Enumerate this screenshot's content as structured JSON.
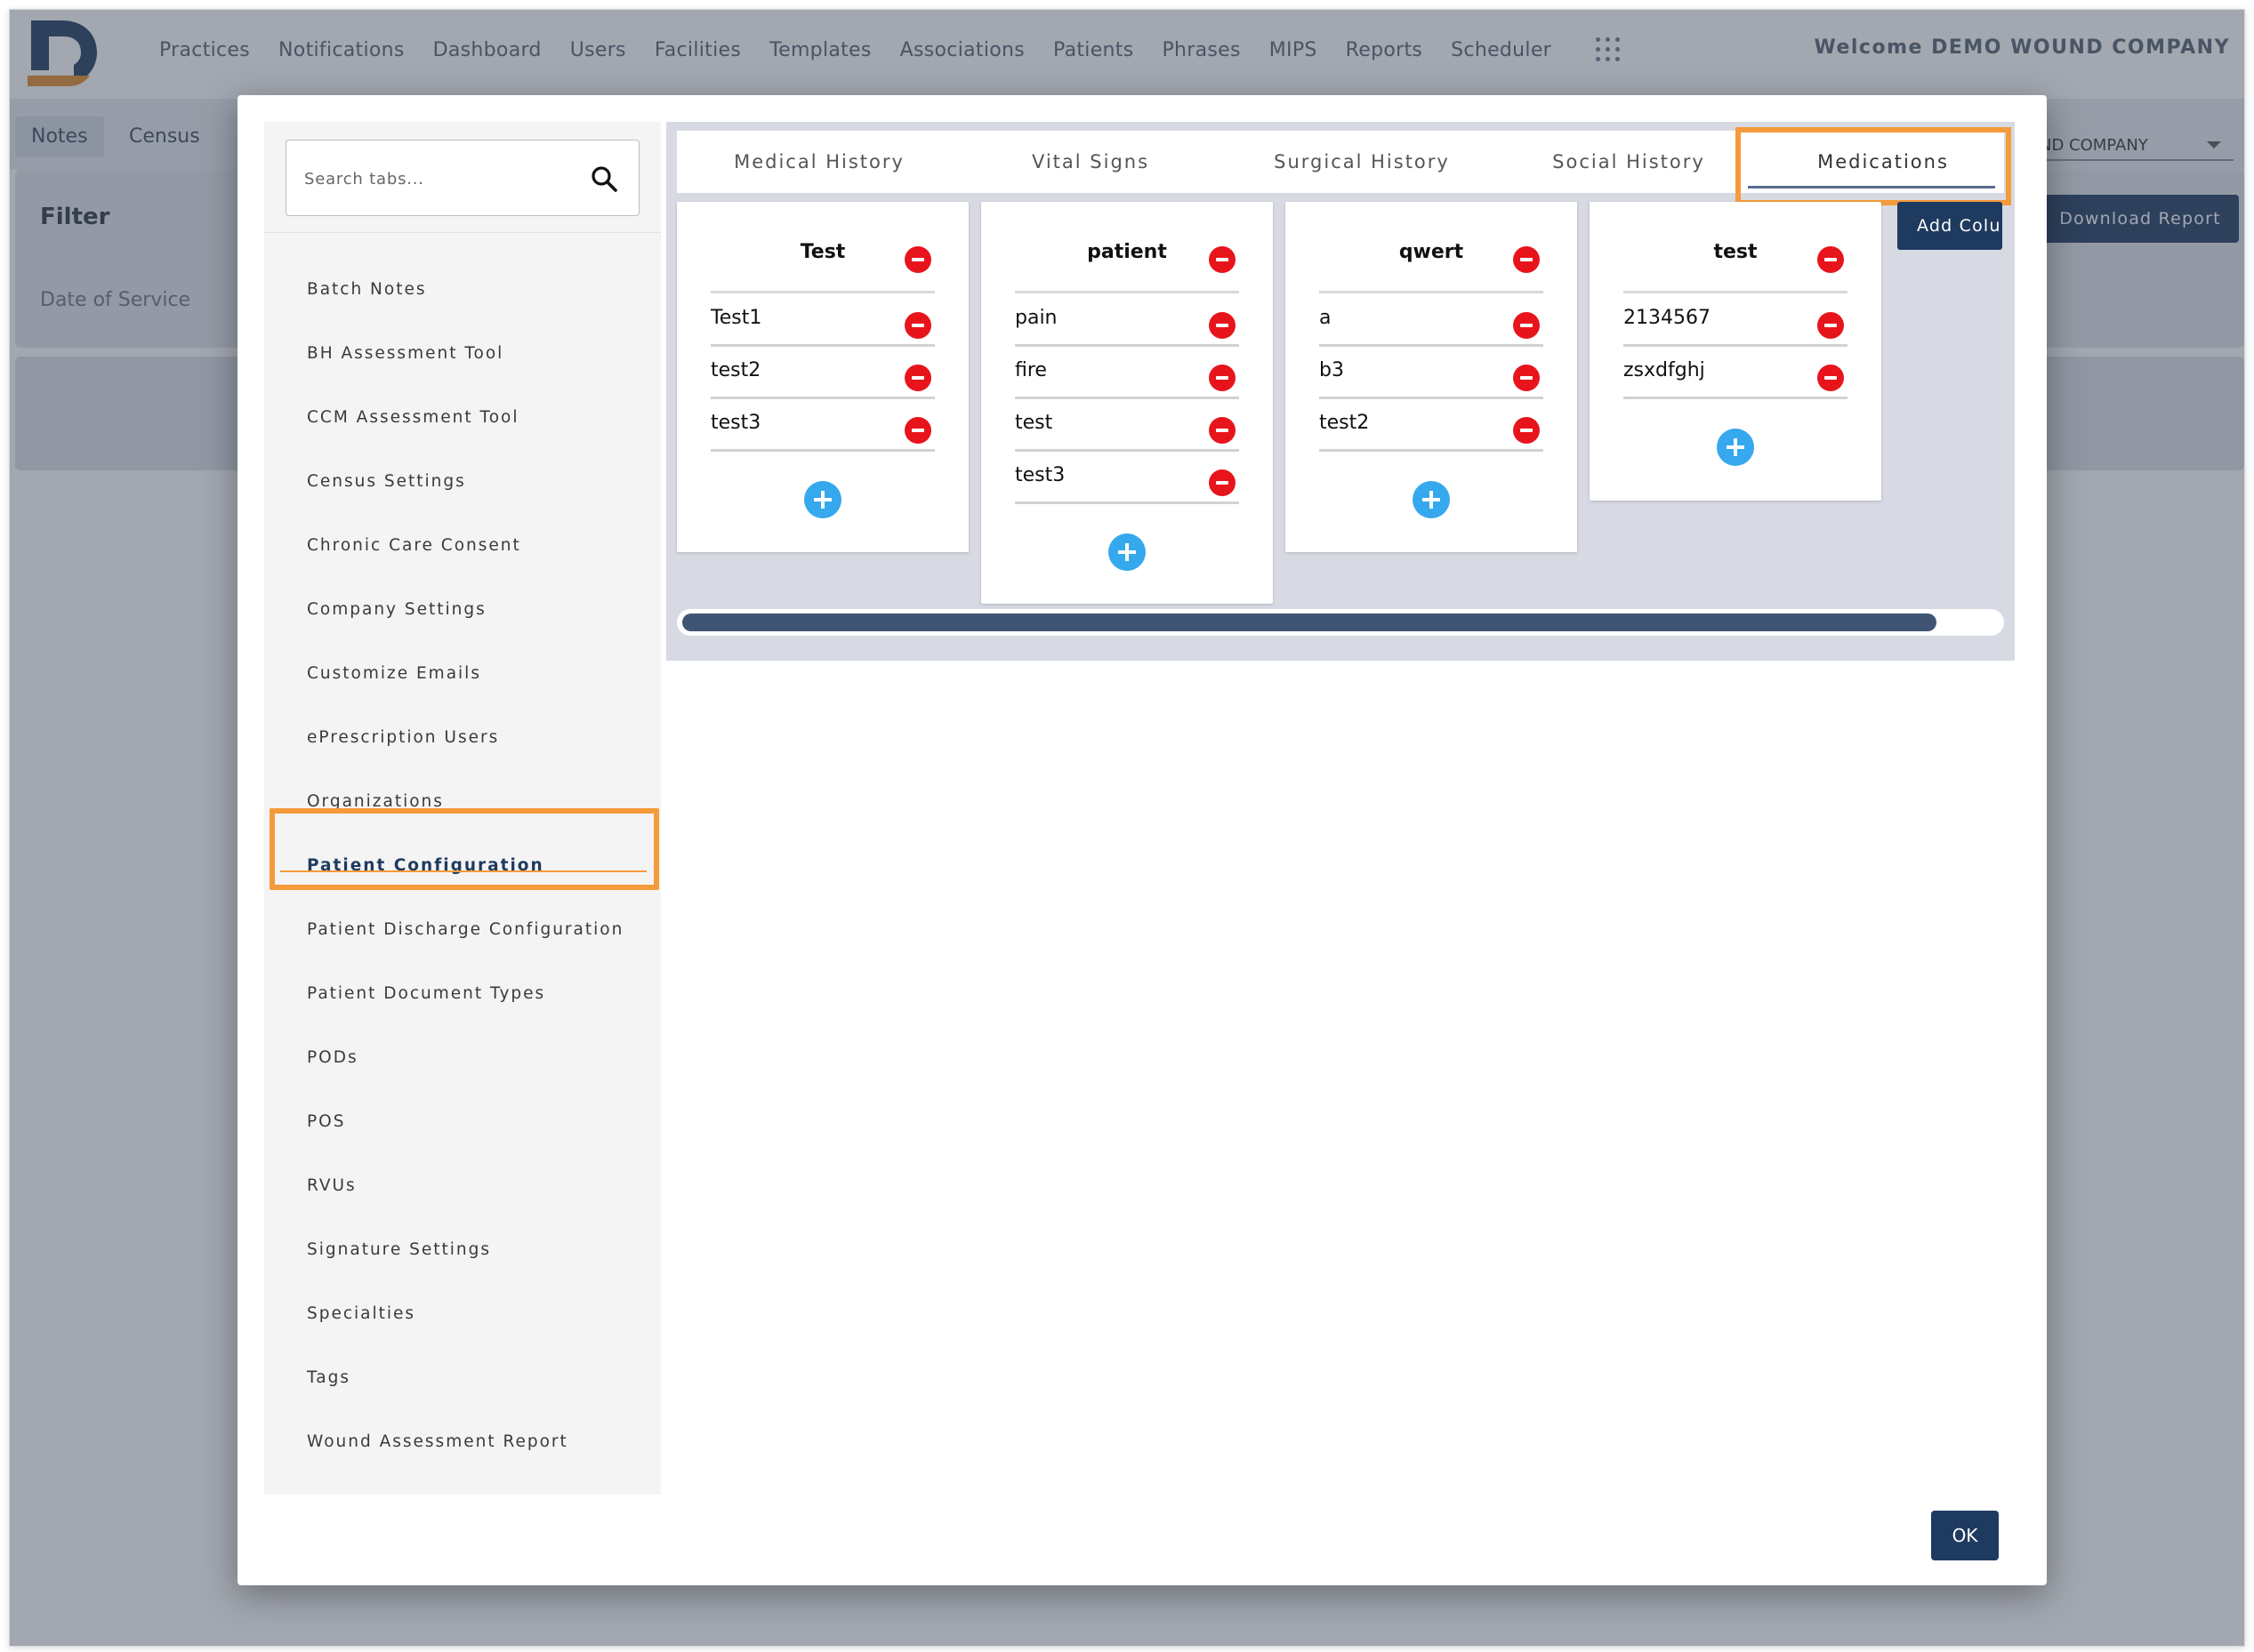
{
  "app": {
    "welcome": "Welcome DEMO WOUND COMPANY",
    "nav": [
      "Practices",
      "Notifications",
      "Dashboard",
      "Users",
      "Facilities",
      "Templates",
      "Associations",
      "Patients",
      "Phrases",
      "MIPS",
      "Reports",
      "Scheduler"
    ],
    "subtabs": [
      "Notes",
      "Census"
    ],
    "filter_title": "Filter",
    "date_of_service_label": "Date of Service",
    "company_select_value": "ND COMPANY",
    "download_report": "Download Report"
  },
  "modal": {
    "search": {
      "placeholder": "Search tabs..."
    },
    "sidebar_items": [
      "Batch Notes",
      "BH Assessment Tool",
      "CCM Assessment Tool",
      "Census Settings",
      "Chronic Care Consent",
      "Company Settings",
      "Customize Emails",
      "ePrescription Users",
      "Organizations",
      "Patient Configuration",
      "Patient Discharge Configuration",
      "Patient Document Types",
      "PODs",
      "POS",
      "RVUs",
      "Signature Settings",
      "Specialties",
      "Tags",
      "Wound Assessment Report"
    ],
    "active_sidebar_item": "Patient Configuration",
    "tabs": [
      "Medical History",
      "Vital Signs",
      "Surgical History",
      "Social History",
      "Medications"
    ],
    "active_tab": "Medications",
    "columns": [
      {
        "title": "Test",
        "items": [
          "Test1",
          "test2",
          "test3"
        ]
      },
      {
        "title": "patient",
        "items": [
          "pain",
          "fire",
          "test",
          "test3"
        ]
      },
      {
        "title": "qwert",
        "items": [
          "a",
          "b3",
          "test2"
        ]
      },
      {
        "title": "test",
        "items": [
          "2134567",
          "zsxdfghj"
        ]
      }
    ],
    "add_column_label": "Add Colu",
    "ok_label": "OK"
  },
  "colors": {
    "primary": "#1f3a5f",
    "highlight": "#f59a3a",
    "delete": "#e8141c",
    "add": "#35a8ee"
  },
  "icons": [
    "logo-icon",
    "apps-grid-icon",
    "search-icon",
    "minus-circle-icon",
    "plus-circle-icon",
    "chevron-down-icon"
  ]
}
